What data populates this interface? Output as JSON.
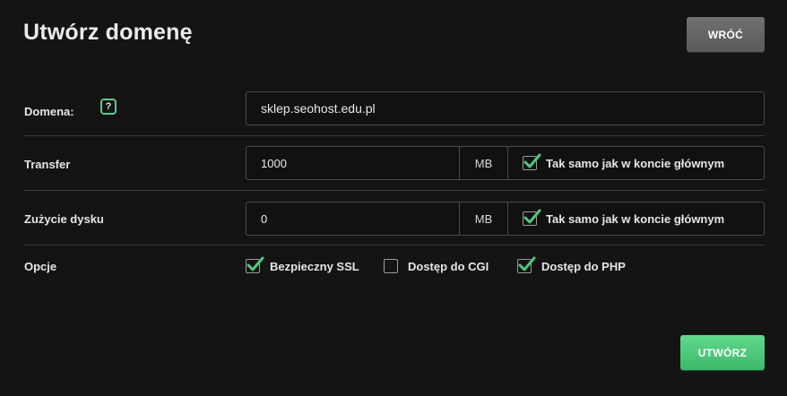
{
  "header": {
    "title": "Utwórz domenę",
    "back_label": "WRÓĆ"
  },
  "domain": {
    "label": "Domena:",
    "help_symbol": "?",
    "value": "sklep.seohost.edu.pl"
  },
  "transfer": {
    "label": "Transfer",
    "value": "1000",
    "unit": "MB",
    "same_label": "Tak samo jak w koncie głównym",
    "same_checked": true
  },
  "disk": {
    "label": "Zużycie dysku",
    "value": "0",
    "unit": "MB",
    "same_label": "Tak samo jak w koncie głównym",
    "same_checked": true
  },
  "options": {
    "label": "Opcje",
    "items": [
      {
        "label": "Bezpieczny SSL",
        "checked": true
      },
      {
        "label": "Dostęp do CGI",
        "checked": false
      },
      {
        "label": "Dostęp do PHP",
        "checked": true
      }
    ]
  },
  "footer": {
    "create_label": "UTWÓRZ"
  },
  "colors": {
    "accent": "#4fc77c",
    "background": "#141414"
  },
  "icons": {
    "help": "question-icon",
    "check": "check-icon"
  }
}
